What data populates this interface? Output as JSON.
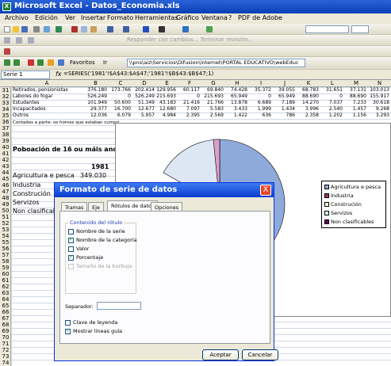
{
  "window": {
    "title": "Microsoft Excel - Datos_Economia.xls"
  },
  "menu": [
    "Archivo",
    "Edición",
    "Ver",
    "Insertar",
    "Formato",
    "Herramientas",
    "Gráfico",
    "Ventana",
    "?",
    "PDF de Adobe"
  ],
  "toolbar3": {
    "reviewing": "Responder con cambios... Terminar revisión..."
  },
  "toolbar4": {
    "favorites": "Favoritos",
    "goto": "Ir",
    "address": "\\\\pns\\aiz\\Servicios\\Difusion\\internet\\PORTAL EDUCATIVO\\webEduc"
  },
  "formula": {
    "namebox": "Serie 1",
    "fx": "fx",
    "value": "=SERIES('1981'!$A$43:$A$47;'1981'!$B$43:$B$47;1)"
  },
  "columns": [
    "A",
    "B",
    "C",
    "D",
    "E",
    "F",
    "G",
    "H",
    "I",
    "J",
    "K",
    "L",
    "M",
    "N"
  ],
  "rows": [
    "31",
    "32",
    "33",
    "34",
    "35",
    "36",
    "37",
    "38",
    "39",
    "40",
    "41",
    "42",
    "43",
    "44",
    "45",
    "46",
    "47",
    "48",
    "49",
    "50",
    "51",
    "52",
    "53",
    "54",
    "55",
    "56",
    "57",
    "58",
    "59",
    "60",
    "61",
    "62",
    "63",
    "64",
    "65",
    "66",
    "67",
    "68",
    "69",
    "70",
    "71",
    "72",
    "73",
    "74"
  ],
  "data_rows": [
    {
      "label": "Retirados, pensionistas",
      "values": [
        "376.180",
        "173.766",
        "202.414",
        "129.956",
        "60.117",
        "69.840",
        "74.428",
        "35.372",
        "39.055",
        "68.783",
        "31.651",
        "37.131",
        "103.013"
      ]
    },
    {
      "label": "Labores do fogar",
      "values": [
        "526.249",
        "0",
        "526.249",
        "215.693",
        "0",
        "215.693",
        "65.949",
        "0",
        "65.949",
        "88.690",
        "0",
        "88.690",
        "155.917"
      ]
    },
    {
      "label": "Estudantes",
      "values": [
        "101.949",
        "50.600",
        "51.349",
        "43.183",
        "21.416",
        "21.766",
        "13.878",
        "6.689",
        "7.189",
        "14.270",
        "7.037",
        "7.233",
        "30.618"
      ]
    },
    {
      "label": "Incapacitados",
      "values": [
        "29.377",
        "16.700",
        "12.677",
        "12.680",
        "7.097",
        "5.583",
        "3.433",
        "1.999",
        "1.434",
        "3.996",
        "2.540",
        "1.457",
        "9.268"
      ]
    },
    {
      "label": "Outros",
      "values": [
        "12.036",
        "6.079",
        "5.957",
        "4.984",
        "2.395",
        "2.569",
        "1.422",
        "636",
        "786",
        "2.358",
        "1.202",
        "1.156",
        "3.293"
      ]
    }
  ],
  "sheet": {
    "note": "Contados a parte: os homes que estaban cumpri",
    "heading": "Poboación de 16 ou máis anos",
    "year": "1981",
    "categories": [
      "Agricultura e pesca",
      "Industria",
      "Construción",
      "Servizos",
      "Non clasificable"
    ],
    "first_value": "349.030"
  },
  "chart": {
    "legend": [
      "Agricultura e pesca",
      "Industria",
      "Construción",
      "Servizos",
      "Non clasificables"
    ],
    "colors": [
      "#8eaadb",
      "#993366",
      "#ffffcc",
      "#ccffff",
      "#660066"
    ]
  },
  "dialog": {
    "title": "Formato de serie de datos",
    "close": "X",
    "tabs": [
      "Tramas",
      "Eje",
      "Rótulos de datos",
      "Opciones"
    ],
    "group_label": "Contenido del rótulo",
    "checks": [
      {
        "label": "Nombre de la serie",
        "checked": false,
        "disabled": false
      },
      {
        "label": "Nombre de la categoría",
        "checked": true,
        "disabled": false
      },
      {
        "label": "Valor",
        "checked": false,
        "disabled": false
      },
      {
        "label": "Porcentaje",
        "checked": true,
        "disabled": false
      },
      {
        "label": "Tamaño de la burbuja",
        "checked": false,
        "disabled": true
      }
    ],
    "separator_label": "Separador:",
    "legend_key": "Clave de leyenda",
    "leader_lines": "Mostrar líneas guía",
    "ok": "Aceptar",
    "cancel": "Cancelar"
  }
}
